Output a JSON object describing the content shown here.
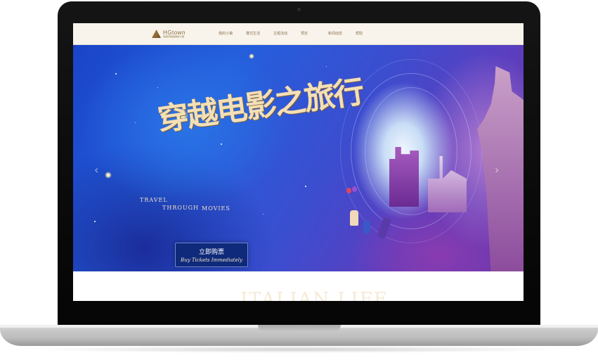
{
  "site": {
    "logo": {
      "name": "HGtown",
      "tagline": "家庭影院集团电影小镇"
    },
    "nav": [
      "我的小镇",
      "赛式生活",
      "主题活动",
      "预定",
      "新闻动态",
      "帮助"
    ]
  },
  "hero": {
    "title_cn": "穿越电影之旅行",
    "title_en": [
      "TRAVEL",
      "THROUGH",
      "MOVIES"
    ],
    "cta": {
      "cn": "立即购票",
      "en": "Buy Tickets Immediately"
    },
    "prev_arrow": "‹",
    "next_arrow": "›",
    "slides": 3,
    "active_slide": 1
  },
  "section": {
    "watermark": "ITALIAN LIFE"
  },
  "colors": {
    "nav_bg": "#f8f4ec",
    "nav_text": "#8d7352",
    "cta_bg": "#0f2a7a",
    "title_gold": "#f3dfb8"
  }
}
